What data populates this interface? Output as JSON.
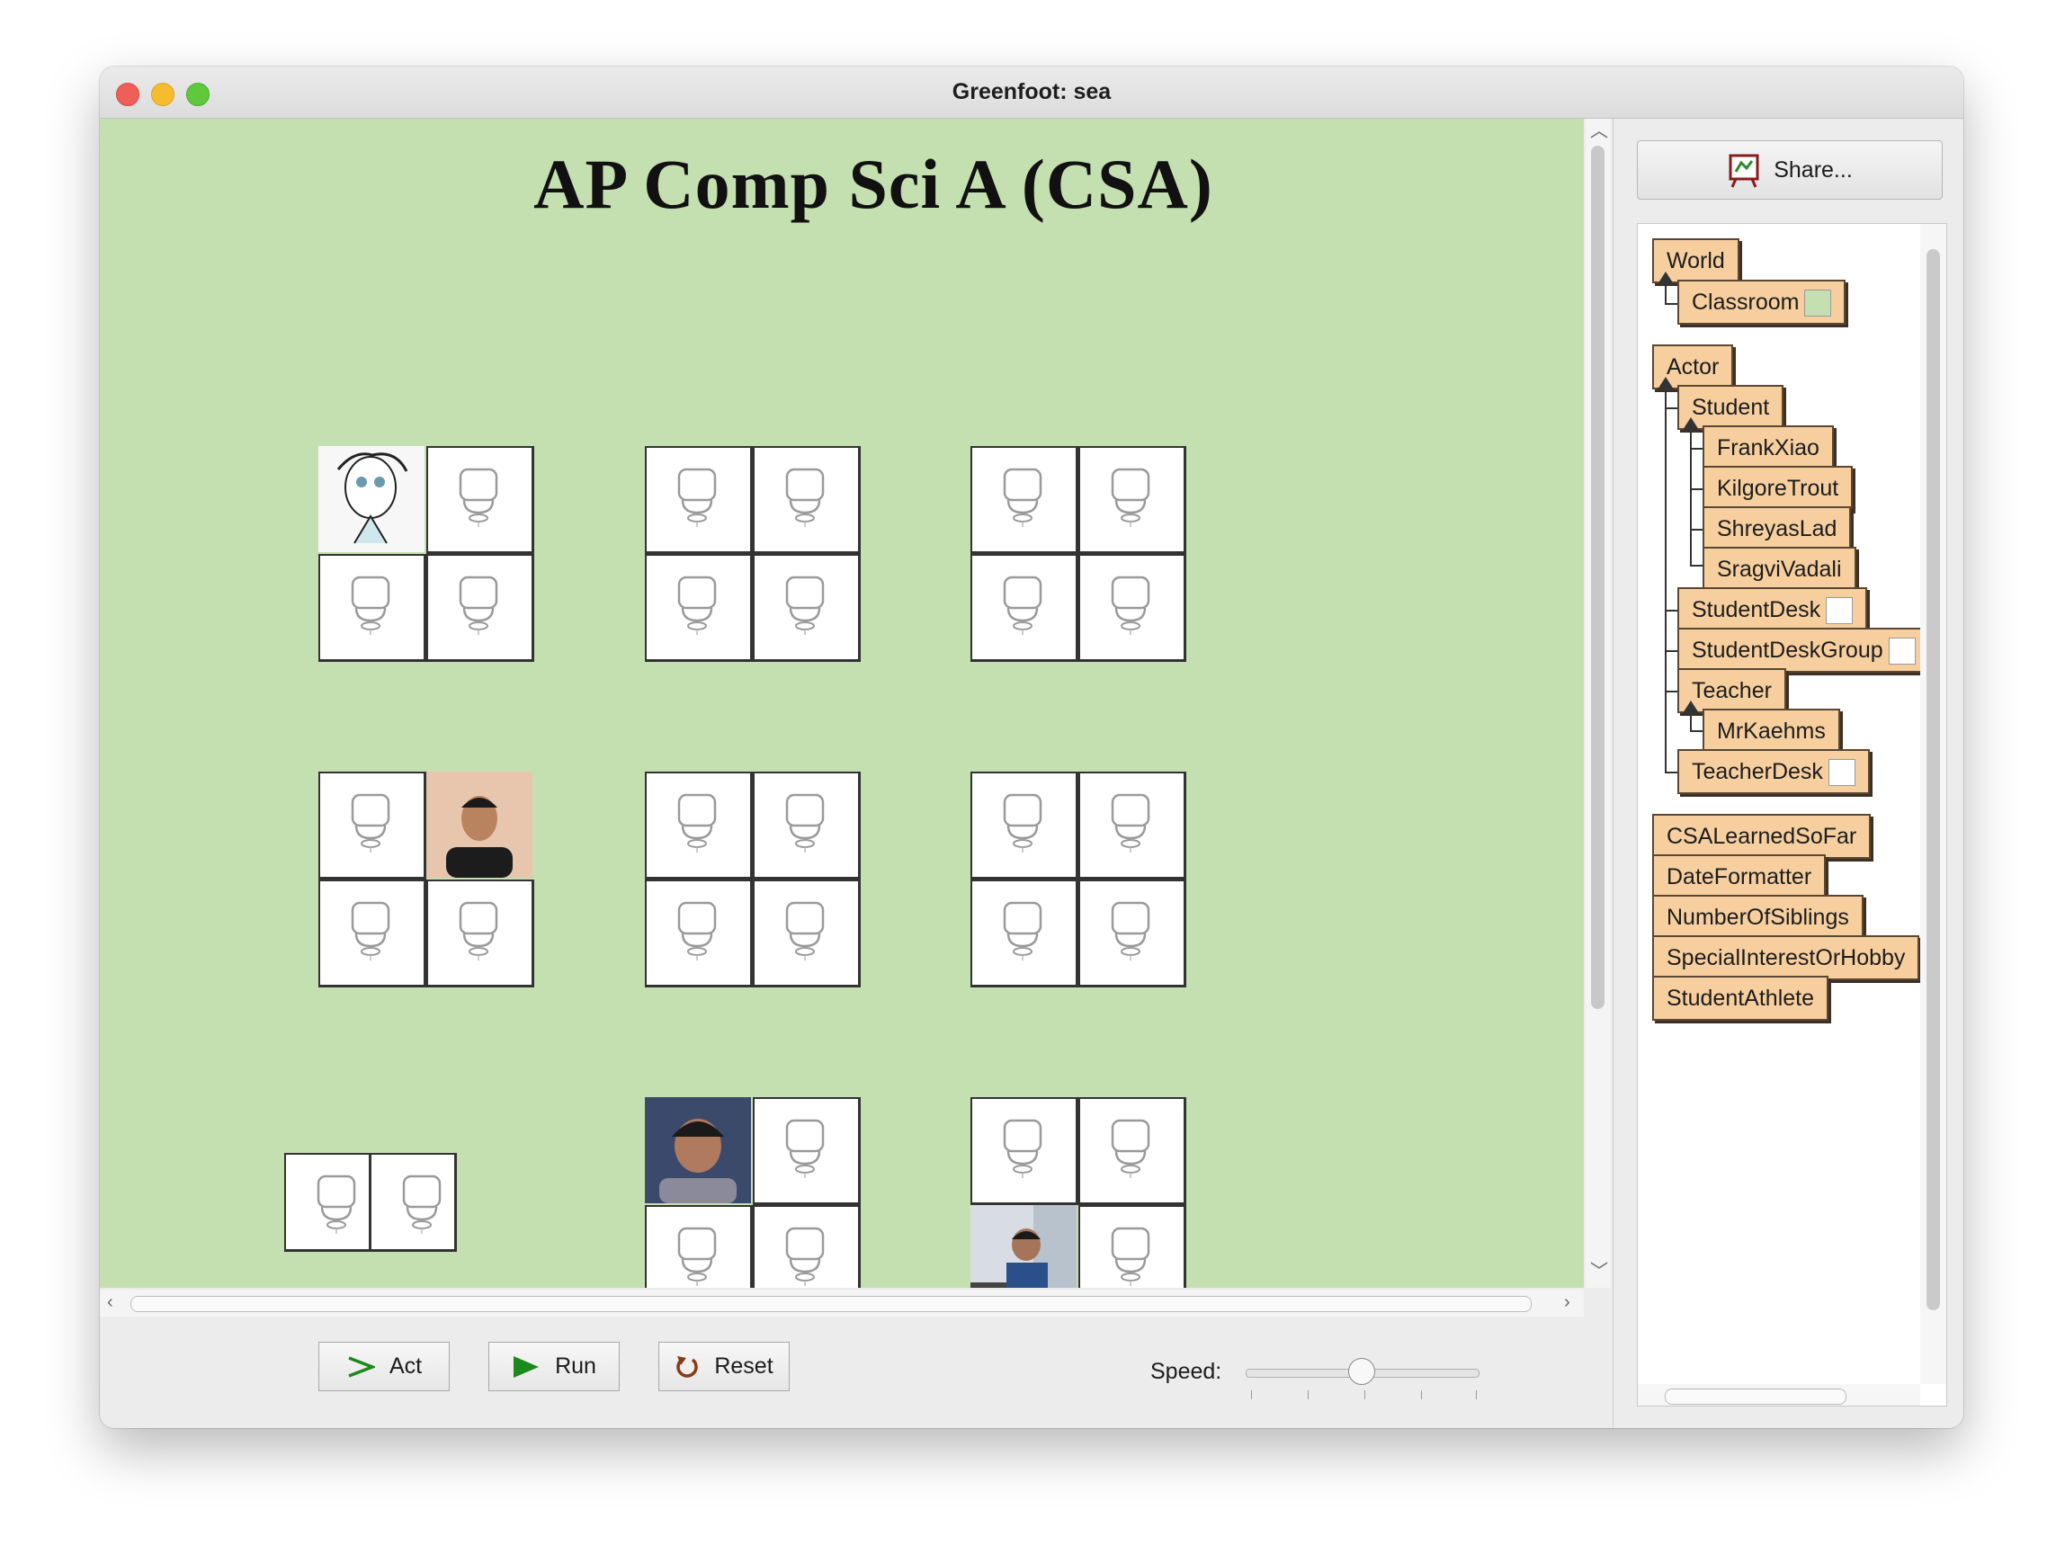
{
  "window": {
    "title": "Greenfoot: sea"
  },
  "world": {
    "title": "AP Comp Sci A (CSA)"
  },
  "controls": {
    "act_label": "Act",
    "run_label": "Run",
    "reset_label": "Reset",
    "speed_label": "Speed:",
    "speed_value": 0.5
  },
  "share": {
    "label": "Share..."
  },
  "class_tree": {
    "world_root": "World",
    "world_children": [
      "Classroom"
    ],
    "actor_root": "Actor",
    "student": "Student",
    "student_children": [
      "FrankXiao",
      "KilgoreTrout",
      "ShreyasLad",
      "SragviVadali"
    ],
    "student_desk": "StudentDesk",
    "student_desk_group": "StudentDeskGroup",
    "teacher": "Teacher",
    "teacher_children": [
      "MrKaehms"
    ],
    "teacher_desk": "TeacherDesk",
    "other_classes": [
      "CSALearnedSoFar",
      "DateFormatter",
      "NumberOfSiblings",
      "SpecialInterestOrHobby",
      "StudentAthlete"
    ]
  },
  "colors": {
    "world_background": "#c4dfb0",
    "class_box": "#f7cf9f",
    "act_icon": "#1a8a1a",
    "run_icon": "#1a8a1a",
    "reset_icon": "#8a3a10"
  }
}
